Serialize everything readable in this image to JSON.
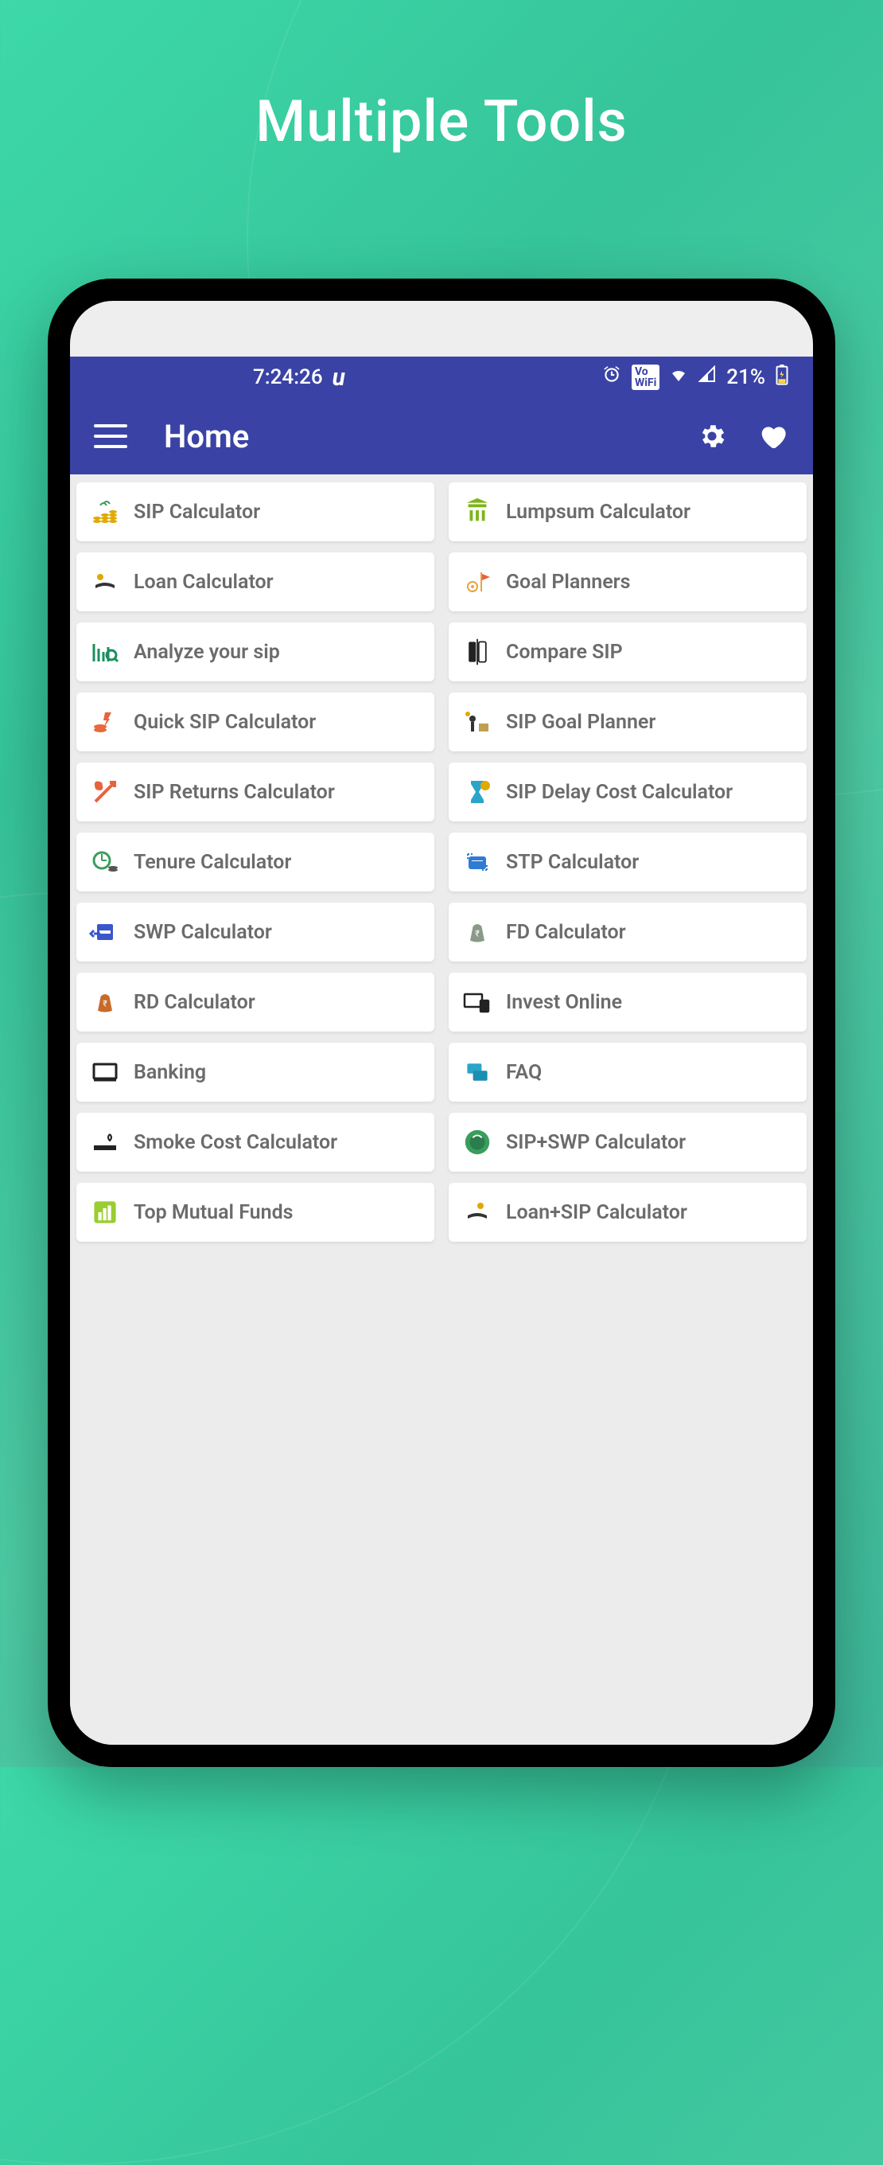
{
  "promo": {
    "title": "Multiple Tools"
  },
  "status": {
    "time": "7:24:26",
    "vowifi": "VoWiFi",
    "battery": "21%"
  },
  "appbar": {
    "title": "Home"
  },
  "tools": [
    {
      "id": "sip",
      "label": "SIP Calculator",
      "color": "#e0a800"
    },
    {
      "id": "lumpsum",
      "label": "Lumpsum Calculator",
      "color": "#7cb518"
    },
    {
      "id": "loan",
      "label": "Loan Calculator",
      "color": "#333"
    },
    {
      "id": "goal",
      "label": "Goal Planners",
      "color": "#e8a33c"
    },
    {
      "id": "analyze",
      "label": "Analyze your sip",
      "color": "#1a8f5c"
    },
    {
      "id": "compare",
      "label": "Compare SIP",
      "color": "#222"
    },
    {
      "id": "quick",
      "label": "Quick SIP Calculator",
      "color": "#e86a3c"
    },
    {
      "id": "goalplan",
      "label": "SIP Goal Planner",
      "color": "#c0a050"
    },
    {
      "id": "returns",
      "label": "SIP Returns Calculator",
      "color": "#e8623c"
    },
    {
      "id": "delay",
      "label": "SIP Delay Cost Calculator",
      "color": "#2aa5c9"
    },
    {
      "id": "tenure",
      "label": "Tenure Calculator",
      "color": "#3a9d5c"
    },
    {
      "id": "stp",
      "label": "STP Calculator",
      "color": "#2f7bd4"
    },
    {
      "id": "swp",
      "label": "SWP Calculator",
      "color": "#3a56c9"
    },
    {
      "id": "fd",
      "label": "FD Calculator",
      "color": "#8a9a88"
    },
    {
      "id": "rd",
      "label": "RD Calculator",
      "color": "#c76b2a"
    },
    {
      "id": "invest",
      "label": "Invest Online",
      "color": "#222"
    },
    {
      "id": "banking",
      "label": "Banking",
      "color": "#222"
    },
    {
      "id": "faq",
      "label": "FAQ",
      "color": "#2aa5c9"
    },
    {
      "id": "smoke",
      "label": "Smoke Cost Calculator",
      "color": "#222"
    },
    {
      "id": "sipswp",
      "label": "SIP+SWP Calculator",
      "color": "#3a9d5c"
    },
    {
      "id": "topmf",
      "label": "Top Mutual Funds",
      "color": "#9acd32"
    },
    {
      "id": "loansip",
      "label": "Loan+SIP Calculator",
      "color": "#333"
    }
  ]
}
